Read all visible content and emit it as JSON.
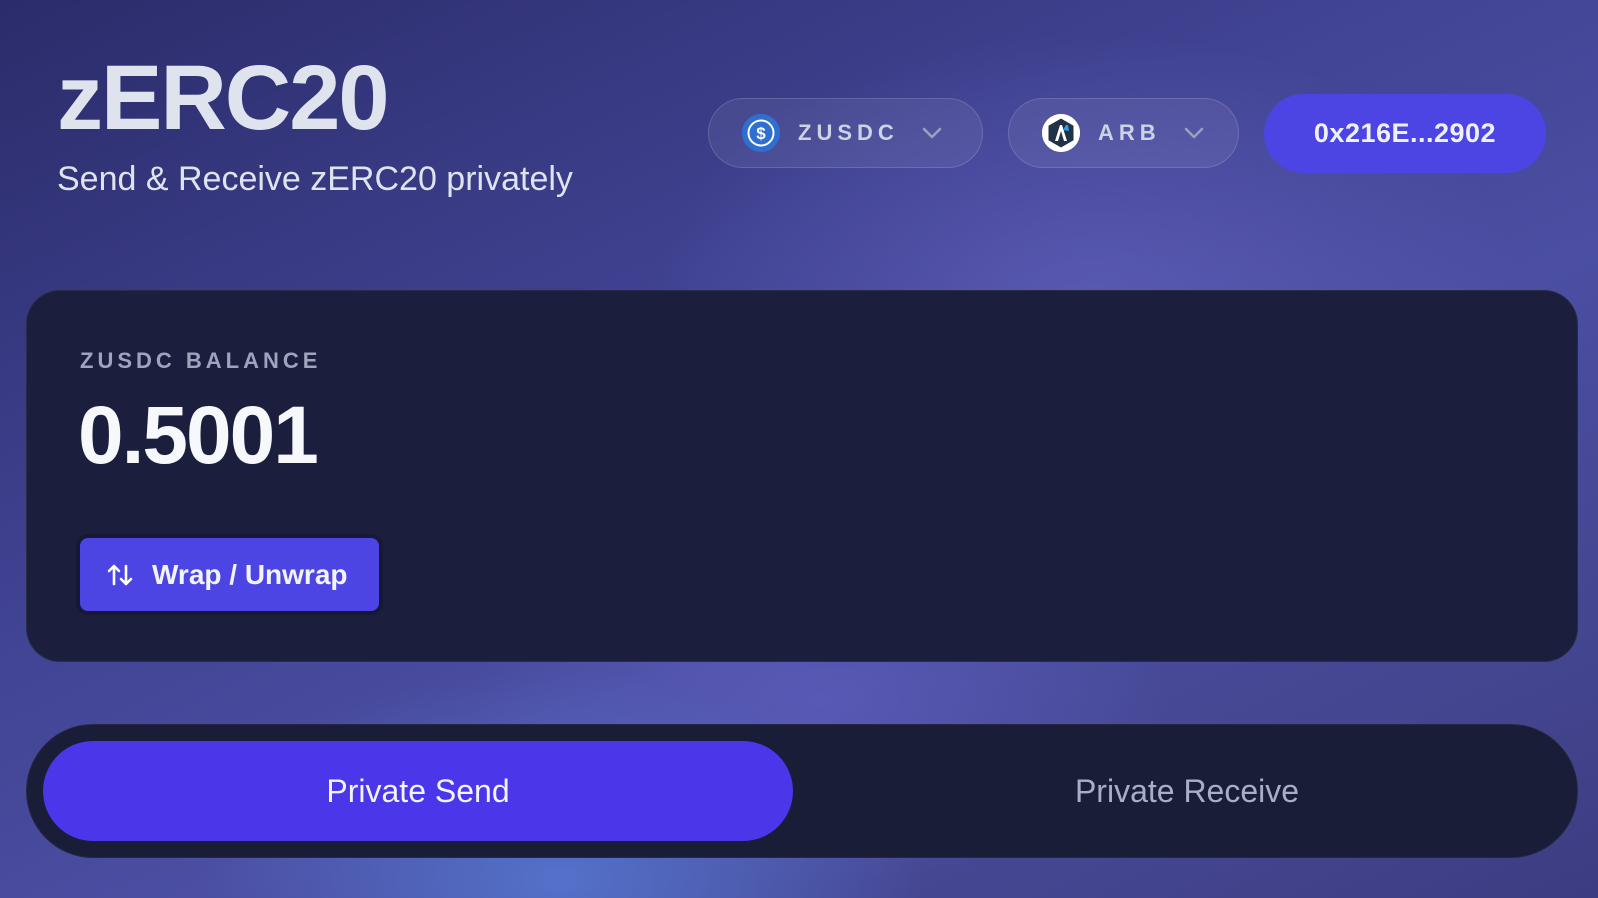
{
  "header": {
    "title": "zERC20",
    "subtitle": "Send & Receive zERC20 privately"
  },
  "token_selector": {
    "icon": "usdc-dollar-icon",
    "label": "ZUSDC"
  },
  "chain_selector": {
    "icon": "arbitrum-icon",
    "label": "ARB"
  },
  "wallet": {
    "address": "0x216E...2902"
  },
  "balance": {
    "label": "ZUSDC BALANCE",
    "value": "0.5001"
  },
  "wrap_button": {
    "icon": "swap-arrows-icon",
    "label": "Wrap / Unwrap"
  },
  "tabs": [
    {
      "label": "Private Send",
      "active": true
    },
    {
      "label": "Private Receive",
      "active": false
    }
  ],
  "colors": {
    "accent": "#4c45e4",
    "active_tab": "#4a37ea",
    "card_bg": "#1b1f3d"
  }
}
